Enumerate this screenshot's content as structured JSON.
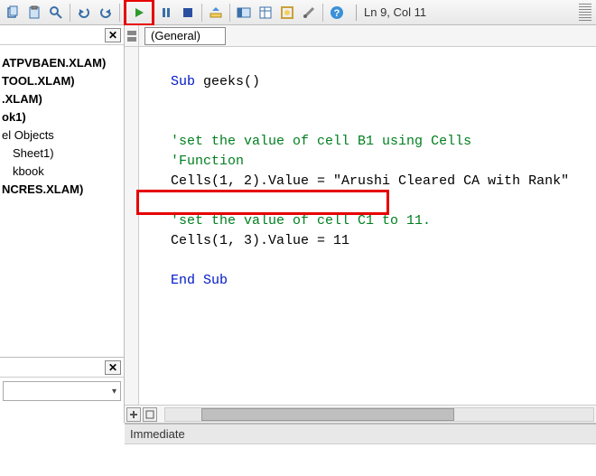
{
  "toolbar": {
    "status": "Ln 9, Col 11"
  },
  "dropdown": {
    "general": "(General)"
  },
  "tree": {
    "items": [
      {
        "label": "ATPVBAEN.XLAM)",
        "bold": true,
        "indent": false
      },
      {
        "label": "TOOL.XLAM)",
        "bold": true,
        "indent": false
      },
      {
        "label": ".XLAM)",
        "bold": true,
        "indent": false
      },
      {
        "label": "ok1)",
        "bold": true,
        "indent": false
      },
      {
        "label": "el Objects",
        "bold": false,
        "indent": false
      },
      {
        "label": "Sheet1)",
        "bold": false,
        "indent": true
      },
      {
        "label": "kbook",
        "bold": false,
        "indent": true
      },
      {
        "label": "",
        "bold": false,
        "indent": false
      },
      {
        "label": "",
        "bold": false,
        "indent": false
      },
      {
        "label": "NCRES.XLAM)",
        "bold": true,
        "indent": false
      }
    ]
  },
  "code": {
    "l1a": "Sub",
    "l1b": " geeks()",
    "c1": "'set the value of cell B1 using Cells",
    "c2": "'Function",
    "l3": "Cells(1, 2).Value = \"Arushi Cleared CA with Rank\"",
    "c3": "'set the value of cell C1 to 11.",
    "l4": "Cells(1, 3).Value = 11",
    "l5": "End Sub"
  },
  "immediate": {
    "title": "Immediate"
  }
}
